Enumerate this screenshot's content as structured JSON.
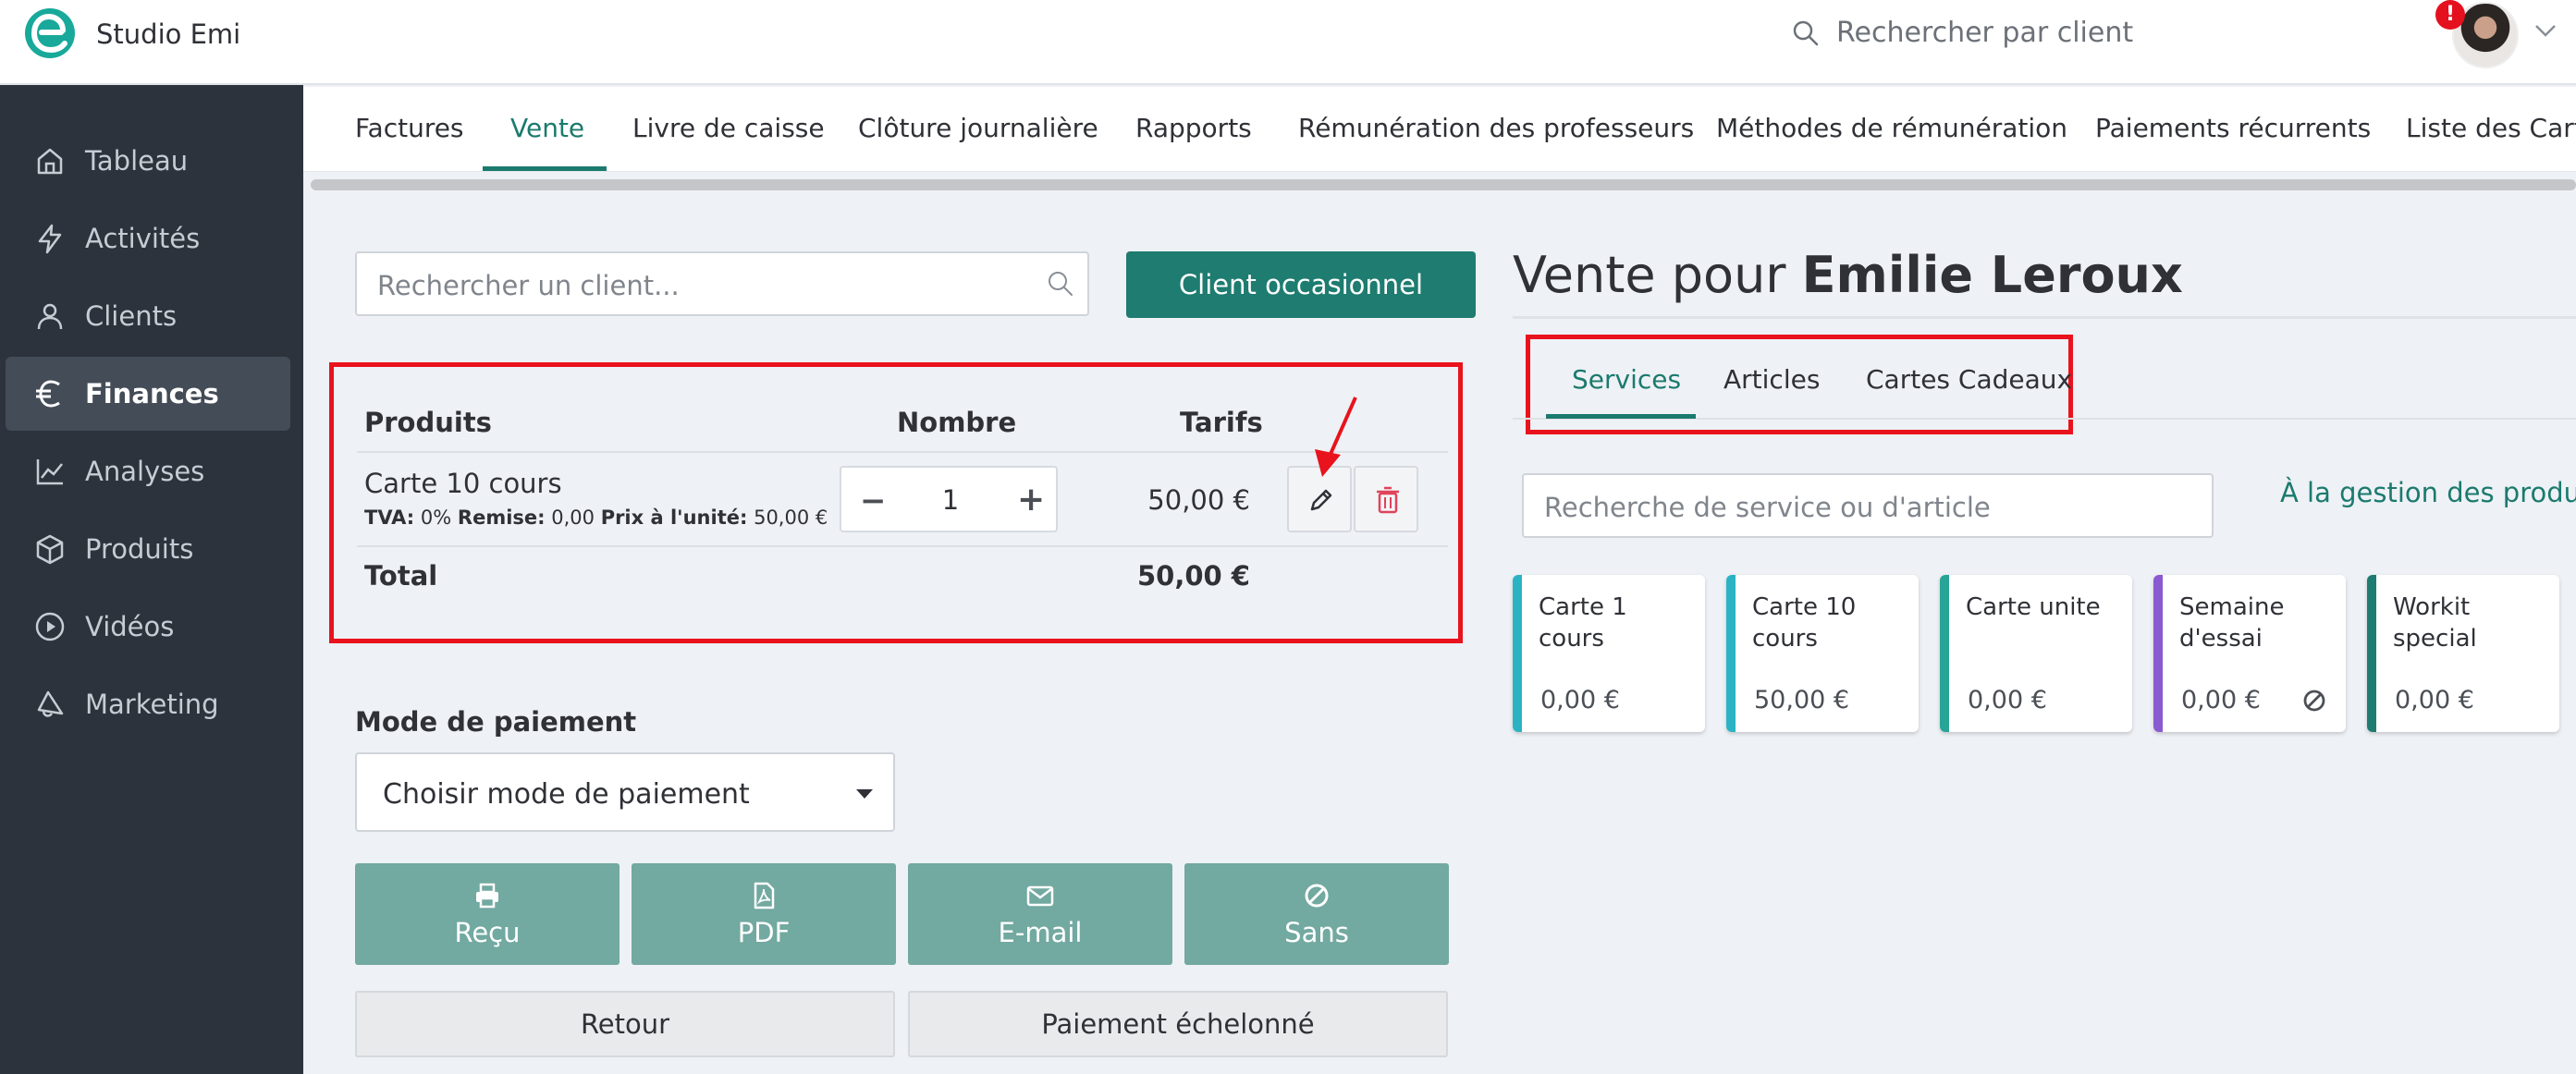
{
  "header": {
    "studio_name": "Studio Emi",
    "search_placeholder": "Rechercher par client",
    "notification_badge": "!"
  },
  "sidebar": {
    "items": [
      {
        "label": "Tableau",
        "icon": "home-icon"
      },
      {
        "label": "Activités",
        "icon": "lightning-icon"
      },
      {
        "label": "Clients",
        "icon": "user-icon"
      },
      {
        "label": "Finances",
        "icon": "euro-icon",
        "active": true
      },
      {
        "label": "Analyses",
        "icon": "chart-icon"
      },
      {
        "label": "Produits",
        "icon": "box-icon"
      },
      {
        "label": "Vidéos",
        "icon": "play-icon"
      },
      {
        "label": "Marketing",
        "icon": "megaphone-icon"
      }
    ]
  },
  "tabs": [
    {
      "label": "Factures"
    },
    {
      "label": "Vente",
      "active": true
    },
    {
      "label": "Livre de caisse"
    },
    {
      "label": "Clôture journalière"
    },
    {
      "label": "Rapports"
    },
    {
      "label": "Rémunération des professeurs"
    },
    {
      "label": "Méthodes de rémunération"
    },
    {
      "label": "Paiements récurrents"
    },
    {
      "label": "Liste des Carte"
    }
  ],
  "left": {
    "client_search_placeholder": "Rechercher un client...",
    "occasional_button": "Client occasionnel",
    "cart": {
      "headers": {
        "products": "Produits",
        "quantity": "Nombre",
        "price": "Tarifs"
      },
      "item": {
        "name": "Carte 10 cours",
        "tva_label": "TVA:",
        "tva_value": "0%",
        "discount_label": "Remise:",
        "discount_value": "0,00",
        "unit_label": "Prix à l'unité:",
        "unit_value": "50,00 €",
        "quantity": "1",
        "price": "50,00 €"
      },
      "total_label": "Total",
      "total_value": "50,00 €"
    },
    "payment": {
      "label": "Mode de paiement",
      "select_value": "Choisir mode de paiement"
    },
    "actions": {
      "receipt": "Reçu",
      "pdf": "PDF",
      "email": "E-mail",
      "none": "Sans",
      "back": "Retour",
      "installment": "Paiement échelonné"
    }
  },
  "right": {
    "title_prefix": "Vente pour",
    "client_name": "Emilie Leroux",
    "tabs": [
      "Services",
      "Articles",
      "Cartes Cadeaux"
    ],
    "service_search_placeholder": "Recherche de service ou d'article",
    "products_link": "À la gestion des produits",
    "cards": [
      {
        "name": "Carte 1 cours",
        "price": "0,00 €",
        "color": "#2bb3c4"
      },
      {
        "name": "Carte 10 cours",
        "price": "50,00 €",
        "color": "#2bb3c4"
      },
      {
        "name": "Carte unite",
        "price": "0,00 €",
        "color": "#26a597"
      },
      {
        "name": "Semaine d'essai",
        "price": "0,00 €",
        "color": "#8a5ad0",
        "icon": "ban-icon"
      },
      {
        "name": "Workit special",
        "price": "0,00 €",
        "color": "#1e7c70"
      }
    ]
  },
  "colors": {
    "accent": "#1e7c70",
    "sidebar_bg": "#2c333d",
    "highlight": "#e8131c",
    "action_button": "#72a9a1",
    "delete": "#e0435a"
  }
}
